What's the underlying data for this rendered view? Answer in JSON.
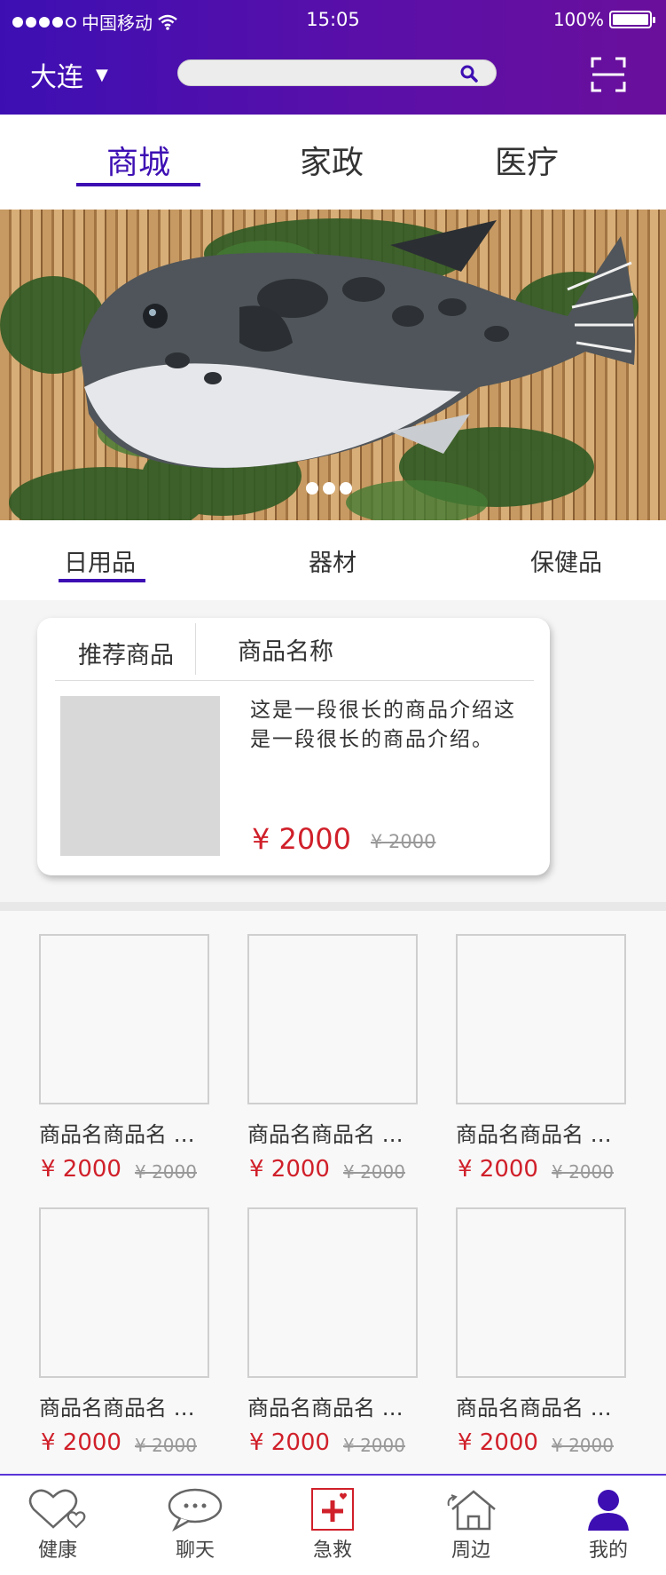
{
  "status_bar": {
    "carrier": "中国移动",
    "time": "15:05",
    "battery": "100%"
  },
  "header": {
    "city": "大连",
    "city_caret": "▼",
    "search_placeholder": ""
  },
  "top_tabs": [
    {
      "label": "商城",
      "active": true
    },
    {
      "label": "家政",
      "active": false
    },
    {
      "label": "医疗",
      "active": false
    }
  ],
  "category_tabs": [
    {
      "label": "日用品",
      "active": true
    },
    {
      "label": "器材",
      "active": false
    },
    {
      "label": "保健品",
      "active": false
    }
  ],
  "recommend": {
    "label": "推荐商品",
    "product_name": "商品名称",
    "description": "这是一段很长的商品介绍这是一段很长的商品介绍。",
    "price": "¥ 2000",
    "old_price": "¥ 2000"
  },
  "products": [
    {
      "name": "商品名商品名 …",
      "price": "¥ 2000",
      "old_price": "¥ 2000"
    },
    {
      "name": "商品名商品名 …",
      "price": "¥ 2000",
      "old_price": "¥ 2000"
    },
    {
      "name": "商品名商品名 …",
      "price": "¥ 2000",
      "old_price": "¥ 2000"
    },
    {
      "name": "商品名商品名 …",
      "price": "¥ 2000",
      "old_price": "¥ 2000"
    },
    {
      "name": "商品名商品名 …",
      "price": "¥ 2000",
      "old_price": "¥ 2000"
    },
    {
      "name": "商品名商品名 …",
      "price": "¥ 2000",
      "old_price": "¥ 2000"
    }
  ],
  "bottom_nav": [
    {
      "label": "健康",
      "icon": "heart-icon"
    },
    {
      "label": "聊天",
      "icon": "chat-icon"
    },
    {
      "label": "急救",
      "icon": "first-aid-icon"
    },
    {
      "label": "周边",
      "icon": "home-icon"
    },
    {
      "label": "我的",
      "icon": "user-icon"
    }
  ],
  "colors": {
    "primary": "#3d0fb3",
    "price_red": "#d0202a"
  }
}
